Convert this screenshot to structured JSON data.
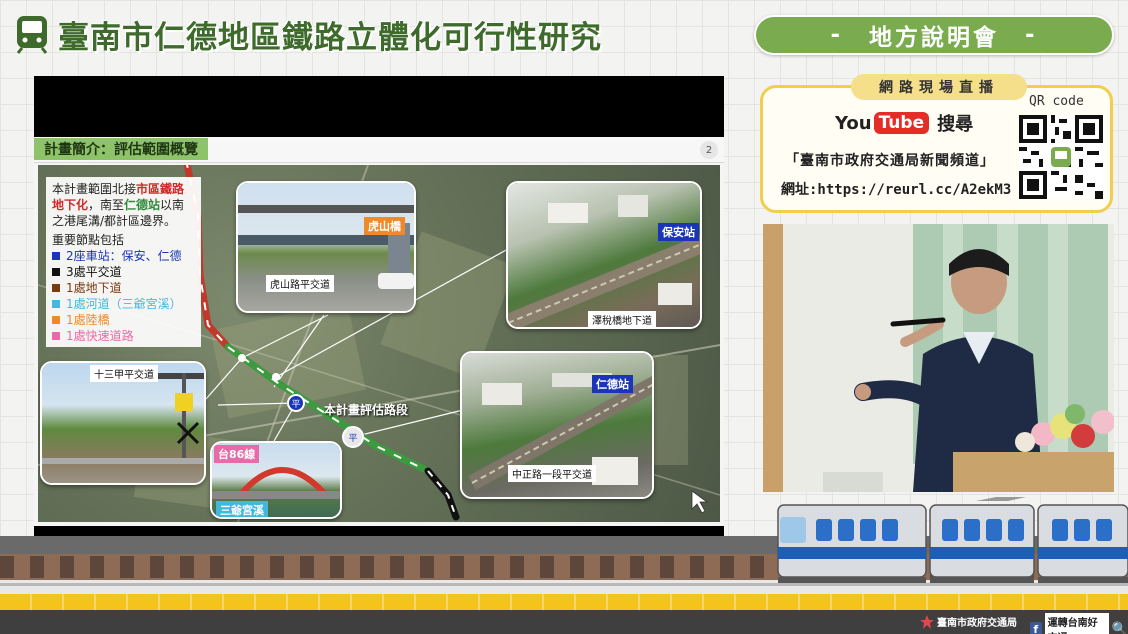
{
  "header": {
    "title": "臺南市仁德地區鐵路立體化可行性研究",
    "event_dash_left": "-",
    "event_label": "地方說明會",
    "event_dash_right": "-"
  },
  "live": {
    "tag": "網路現場直播",
    "youtube_you": "You",
    "youtube_tube": "Tube",
    "search_label": "搜尋",
    "channel": "「臺南市政府交通局新聞頻道」",
    "url": "網址:https://reurl.cc/A2ekM3",
    "qr_label": "QR code"
  },
  "slide": {
    "title": "計畫簡介：評估範圍概覽",
    "page": "2",
    "info": {
      "line1_a": "本計畫範圍北接",
      "line1_b": "市區鐵路地下化",
      "line1_c": "，南至",
      "line1_d": "仁德站",
      "line1_e": "以南之港尾溝/都計區邊界。",
      "nodes_heading": "重要節點包括",
      "legend": [
        {
          "text": "2座車站：保安、仁德",
          "color": "#1a35b8"
        },
        {
          "text": "3處平交道",
          "color": "#111111"
        },
        {
          "text": "1處地下道",
          "color": "#7a3b12"
        },
        {
          "text": "1處河道（三爺宮溪）",
          "color": "#42b8df"
        },
        {
          "text": "1處陸橋",
          "color": "#ef8a2a"
        },
        {
          "text": "1處快速道路",
          "color": "#e86aa6"
        }
      ]
    },
    "labels": {
      "hushan_bridge": "虎山橋",
      "hushan_crossing": "虎山路平交道",
      "baoan_station": "保安站",
      "zeqiao_underpass": "澤稅橋地下道",
      "shisanjia_crossing": "十三甲平交道",
      "route86": "台86線",
      "sanyegong": "三爺宮溪",
      "rende_station": "仁德站",
      "zhongzheng_crossing": "中正路一段平交道",
      "segment": "本計畫評估路段"
    }
  },
  "footer": {
    "org": "臺南市政府交通局",
    "fb_icon": "f",
    "fb_name": "運轉台南好交通",
    "search_glyph": "🔍"
  },
  "colors": {
    "title_green": "#3e6b2c",
    "banner_green": "#7aab4f",
    "yellow": "#f4c31c",
    "tab_green": "#8fc36a"
  }
}
